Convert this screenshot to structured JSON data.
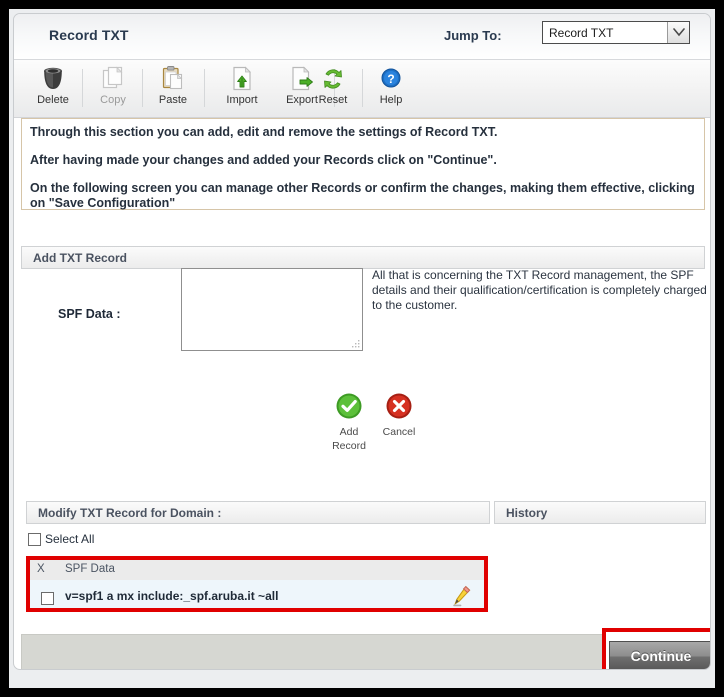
{
  "header": {
    "title": "Record TXT",
    "jump_label": "Jump To:",
    "jump_value": "Record TXT"
  },
  "toolbar": {
    "items": [
      {
        "label": "Delete",
        "icon": "trash-icon",
        "disabled": false
      },
      {
        "label": "Copy",
        "icon": "copy-icon",
        "disabled": true
      },
      {
        "label": "Paste",
        "icon": "paste-icon",
        "disabled": false
      },
      {
        "label": "Import",
        "icon": "import-icon",
        "disabled": false
      },
      {
        "label": "Export",
        "icon": "export-icon",
        "disabled": false
      },
      {
        "label": "Reset",
        "icon": "reset-icon",
        "disabled": false
      },
      {
        "label": "Help",
        "icon": "help-icon",
        "disabled": false
      }
    ]
  },
  "info": {
    "line1": "Through this section you can add, edit and remove the settings of Record TXT.",
    "line2": "After having made your changes and added your Records click on \"Continue\".",
    "line3": "On the following screen you can manage other Records or confirm the changes, making them effective, clicking on \"Save Configuration\""
  },
  "add_section": {
    "header": "Add TXT Record",
    "spf_label": "SPF Data :",
    "spf_value": "",
    "spf_placeholder": "",
    "note": "All that is concerning the TXT Record management, the SPF details and their qualification/certification is completely charged to the customer.",
    "add_button": {
      "line1": "Add",
      "line2": "Record",
      "icon": "check-circle-icon"
    },
    "cancel_button": {
      "label": "Cancel",
      "icon": "cancel-circle-icon"
    }
  },
  "modify_section": {
    "header": "Modify TXT Record for Domain :",
    "history_header": "History",
    "select_all": "Select All",
    "columns": {
      "x": "X",
      "data": "SPF Data"
    },
    "rows": [
      {
        "value": "v=spf1 a mx include:_spf.aruba.it ~all",
        "checked": false,
        "edit_icon": "pencil-icon"
      }
    ]
  },
  "footer": {
    "continue_label": "Continue"
  },
  "colors": {
    "highlight": "#e00000",
    "title": "#2a3a4f",
    "row_bg": "#eef6fb",
    "footer_bg": "#d6d7d2"
  }
}
